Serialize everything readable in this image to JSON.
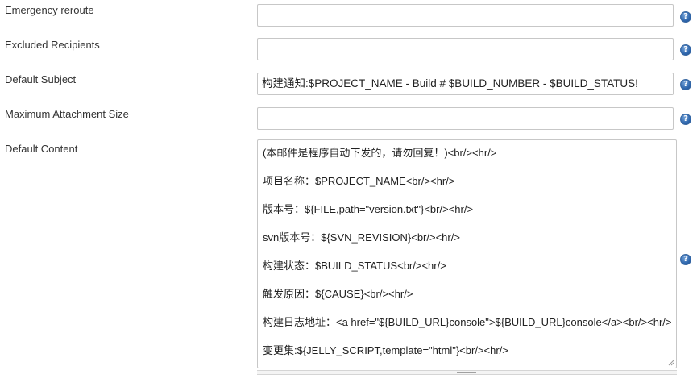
{
  "fields": [
    {
      "label": "Emergency reroute",
      "value": ""
    },
    {
      "label": "Excluded Recipients",
      "value": ""
    },
    {
      "label": "Default Subject",
      "value": "构建通知:$PROJECT_NAME - Build # $BUILD_NUMBER - $BUILD_STATUS!"
    },
    {
      "label": "Maximum Attachment Size",
      "value": ""
    }
  ],
  "default_content": {
    "label": "Default Content",
    "lines": [
      "(本邮件是程序自动下发的，请勿回复！)<br/><hr/>",
      "项目名称：$PROJECT_NAME<br/><hr/>",
      "版本号：${FILE,path=\"version.txt\"}<br/><hr/>",
      "svn版本号：${SVN_REVISION}<br/><hr/>",
      "构建状态：$BUILD_STATUS<br/><hr/>",
      "触发原因：${CAUSE}<br/><hr/>",
      "构建日志地址：<a href=\"${BUILD_URL}console\">${BUILD_URL}console</a><br/><hr/>",
      "变更集:${JELLY_SCRIPT,template=\"html\"}<br/><hr/>"
    ]
  },
  "help_icon_glyph": "?",
  "colors": {
    "help_icon": "#2f67ad",
    "border": "#c7c7c7",
    "label_text": "#333333"
  }
}
